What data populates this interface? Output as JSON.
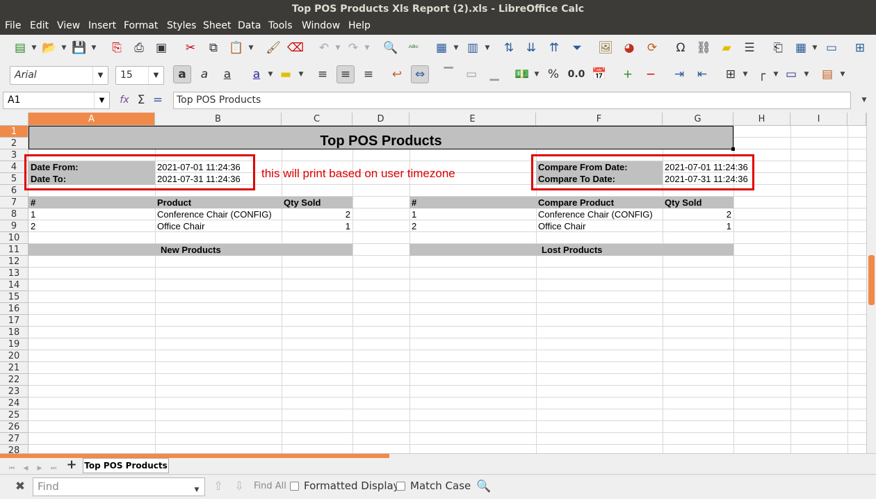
{
  "window_title": "Top POS Products Xls Report (2).xls - LibreOffice Calc",
  "menu": [
    "File",
    "Edit",
    "View",
    "Insert",
    "Format",
    "Styles",
    "Sheet",
    "Data",
    "Tools",
    "Window",
    "Help"
  ],
  "font_name": "Arial",
  "font_size": "15",
  "name_box": "A1",
  "formula": "Top POS Products",
  "columns": [
    "A",
    "B",
    "C",
    "D",
    "E",
    "F",
    "G",
    "H",
    "I"
  ],
  "rows": [
    "1",
    "2",
    "3",
    "4",
    "5",
    "6",
    "7",
    "8",
    "9",
    "10",
    "11",
    "12",
    "13",
    "14",
    "15",
    "16",
    "17",
    "18",
    "19",
    "20",
    "21",
    "22",
    "23",
    "24",
    "25",
    "26",
    "27",
    "28"
  ],
  "sheet": {
    "title": "Top POS Products",
    "date_from_label": "Date From:",
    "date_from": "2021-07-01 11:24:36",
    "date_to_label": "Date To:",
    "date_to": "2021-07-31 11:24:36",
    "compare_from_label": "Compare From Date:",
    "compare_from": "2021-07-01 11:24:36",
    "compare_to_label": "Compare To Date:",
    "compare_to": "2021-07-31 11:24:36",
    "left_table": {
      "headers": [
        "#",
        "Product",
        "Qty Sold"
      ],
      "rows": [
        [
          "1",
          "Conference Chair (CONFIG)",
          "2"
        ],
        [
          "2",
          "Office Chair",
          "1"
        ]
      ]
    },
    "right_table": {
      "headers": [
        "#",
        "Compare Product",
        "Qty Sold"
      ],
      "rows": [
        [
          "1",
          "Conference Chair (CONFIG)",
          "2"
        ],
        [
          "2",
          "Office Chair",
          "1"
        ]
      ]
    },
    "new_products": "New Products",
    "lost_products": "Lost Products"
  },
  "annotation": "this will print based on user timezone",
  "sheet_tab": "Top POS Products",
  "find": {
    "placeholder": "Find",
    "find_all": "Find All",
    "formatted_display": "Formatted Display",
    "match_case": "Match Case"
  },
  "colors": {
    "accent": "#f08a4b",
    "highlight_box": "#e00000",
    "header_fill": "#c0c0c0"
  }
}
